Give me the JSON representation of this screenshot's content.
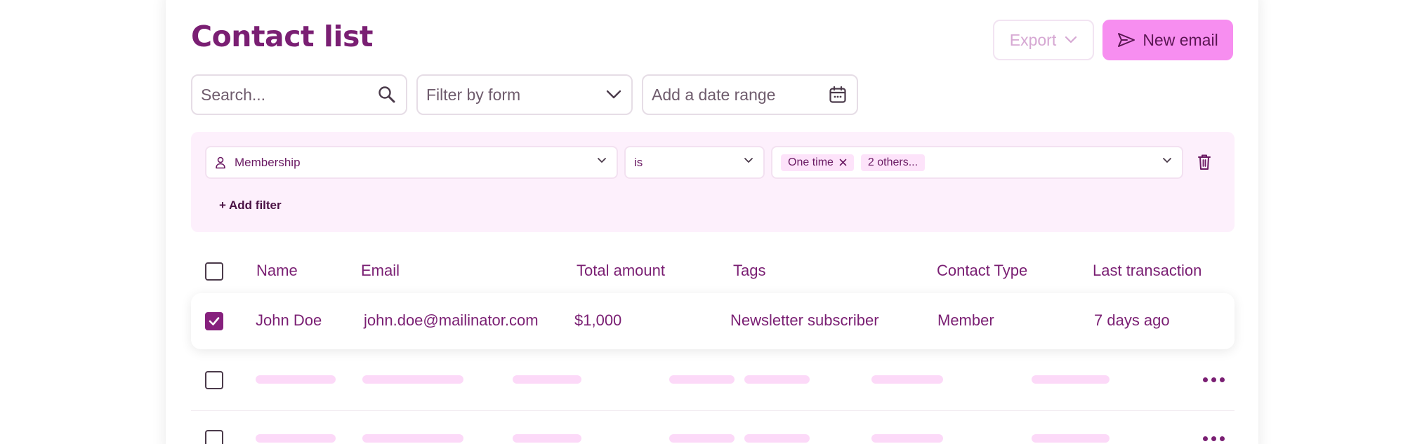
{
  "page": {
    "title": "Contact list",
    "export_label": "Export",
    "new_email_label": "New email"
  },
  "toolbar": {
    "search_placeholder": "Search...",
    "filter_form_label": "Filter by form",
    "date_range_label": "Add a date range"
  },
  "filters": {
    "field_label": "Membership",
    "operator_label": "is",
    "chip_one_time": "One time",
    "chip_others": "2 others...",
    "add_filter_label": "+ Add filter"
  },
  "table": {
    "headers": [
      "Name",
      "Email",
      "Total amount",
      "Tags",
      "Contact Type",
      "Last transaction"
    ],
    "rows": [
      {
        "checked": true,
        "name": "John Doe",
        "email": "john.doe@mailinator.com",
        "total": "$1,000",
        "tags": "Newsletter subscriber",
        "type": "Member",
        "last": "7 days ago"
      }
    ],
    "placeholder_rows": 2
  },
  "colors": {
    "brand": "#7a1f73",
    "primary_button": "#f78ef0",
    "filter_panel": "#fdf0fc",
    "skeleton": "#fcd9f8"
  },
  "icons": [
    "search-icon",
    "chevron-down-icon",
    "calendar-icon",
    "send-icon",
    "user-icon",
    "close-icon",
    "trash-icon",
    "more-icon",
    "check-icon"
  ]
}
